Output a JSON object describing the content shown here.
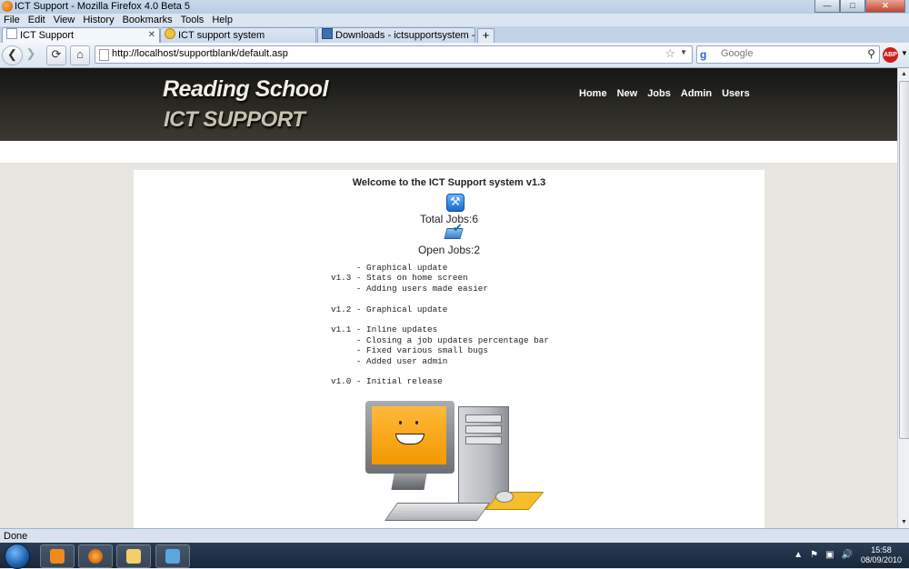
{
  "window": {
    "title": "ICT Support - Mozilla Firefox 4.0 Beta 5"
  },
  "menu": [
    "File",
    "Edit",
    "View",
    "History",
    "Bookmarks",
    "Tools",
    "Help"
  ],
  "tabs": [
    {
      "label": "ICT Support",
      "active": true
    },
    {
      "label": "ICT support system",
      "active": false
    },
    {
      "label": "Downloads - ictsupportsystem - Proj...",
      "active": false
    }
  ],
  "addressbar": {
    "url": "http://localhost/supportblank/default.asp"
  },
  "search": {
    "placeholder": "Google"
  },
  "site": {
    "logo_line1": "Reading School",
    "logo_line2": "ICT SUPPORT",
    "nav": [
      "Home",
      "New",
      "Jobs",
      "Admin",
      "Users"
    ]
  },
  "main": {
    "welcome": "Welcome to the ICT Support system v1.3",
    "total_jobs": "Total Jobs:6",
    "open_jobs": "Open Jobs:2",
    "changelog": "     - Graphical update\nv1.3 - Stats on home screen\n     - Adding users made easier\n\nv1.2 - Graphical update\n\nv1.1 - Inline updates\n     - Closing a job updates percentage bar\n     - Fixed various small bugs\n     - Added user admin\n\nv1.0 - Initial release"
  },
  "status": {
    "text": "Done"
  },
  "clock": {
    "time": "15:58",
    "date": "08/09/2010"
  }
}
